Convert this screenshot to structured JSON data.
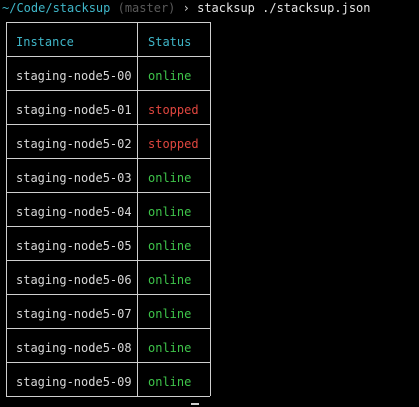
{
  "prompt": {
    "path": "~/Code/stacksup",
    "branch": "(master)",
    "chevron": "›",
    "command": "stacksup ./stacksup.json"
  },
  "table": {
    "headers": [
      "Instance",
      "Status"
    ],
    "rows": [
      {
        "instance": "staging-node5-00",
        "status": "online"
      },
      {
        "instance": "staging-node5-01",
        "status": "stopped"
      },
      {
        "instance": "staging-node5-02",
        "status": "stopped"
      },
      {
        "instance": "staging-node5-03",
        "status": "online"
      },
      {
        "instance": "staging-node5-04",
        "status": "online"
      },
      {
        "instance": "staging-node5-05",
        "status": "online"
      },
      {
        "instance": "staging-node5-06",
        "status": "online"
      },
      {
        "instance": "staging-node5-07",
        "status": "online"
      },
      {
        "instance": "staging-node5-08",
        "status": "online"
      },
      {
        "instance": "staging-node5-09",
        "status": "online"
      }
    ]
  },
  "colors": {
    "path": "#3fb6c8",
    "header": "#3fb6c8",
    "online": "#3ec44a",
    "stopped": "#e0463f",
    "background": "#000000"
  }
}
